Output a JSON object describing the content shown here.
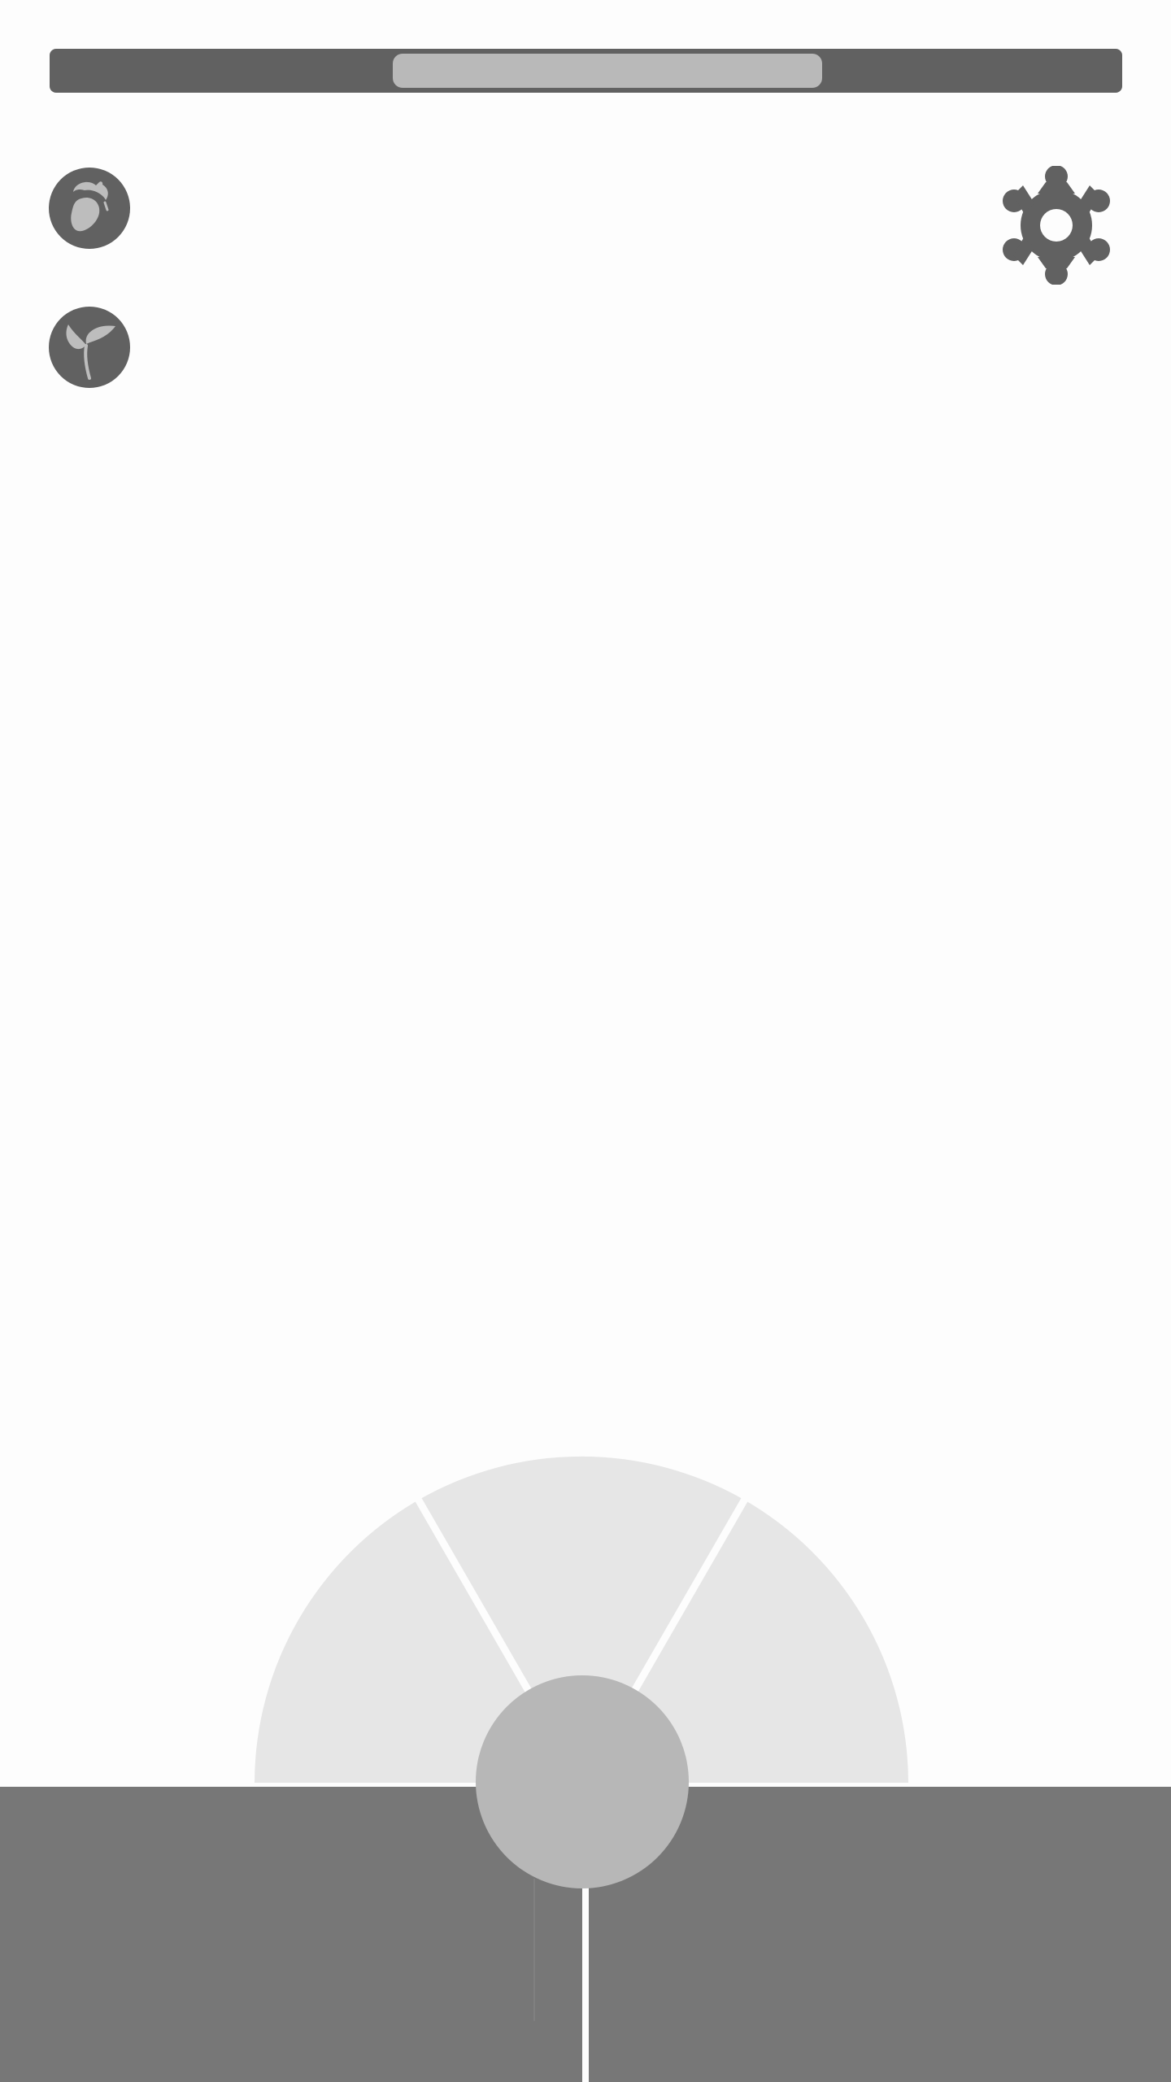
{
  "progress": {
    "start_fraction": 0.32,
    "end_fraction": 0.72
  },
  "buttons": [
    {
      "icon": "acorn-icon"
    },
    {
      "icon": "sprout-icon"
    }
  ],
  "settings": {
    "icon": "gear-icon"
  },
  "radial_menu": {
    "sectors": 3
  },
  "colors": {
    "bar_track": "#616161",
    "bar_fill": "#b9b9b9",
    "button_bg": "#616161",
    "icon_light": "#bdbdbd",
    "sector_fill": "#e6e6e6",
    "ground": "#777777",
    "knob": "#b7b7b7",
    "background": "#fdfdfd"
  }
}
